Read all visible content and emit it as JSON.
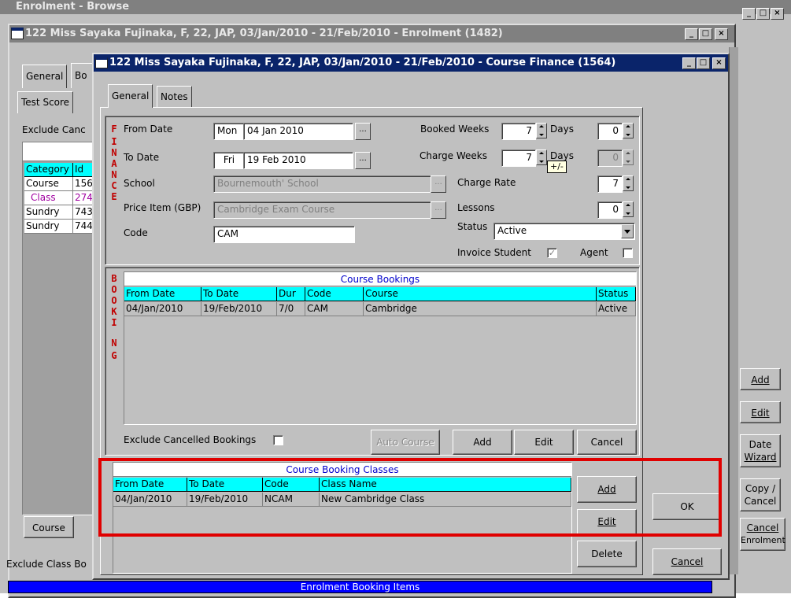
{
  "browse_window": {
    "title": "Enrolment - Browse"
  },
  "enrolment_window": {
    "title": "122 Miss Sayaka Fujinaka, F, 22, JAP, 03/Jan/2010 - 21/Feb/2010 - Enrolment (1482)",
    "tabs": [
      "General",
      "Bo"
    ],
    "subtab": "Test Score",
    "exclude_label": "Exclude Canc",
    "grid_headers": [
      "Category",
      "Id"
    ],
    "grid_rows": [
      [
        "Course",
        "156"
      ],
      [
        "Class",
        "274"
      ],
      [
        "Sundry",
        "743"
      ],
      [
        "Sundry",
        "744"
      ]
    ],
    "course_button": "Course",
    "exclude_class_label": "Exclude Class Bo",
    "bottom_bar": "Enrolment Booking Items",
    "side_buttons": {
      "add": "Add",
      "edit": "Edit",
      "date_wizard": [
        "Date",
        "Wizard"
      ],
      "copy_cancel": [
        "Copy /",
        "Cancel"
      ],
      "cancel_enrolment": [
        "Cancel",
        "Enrolment"
      ]
    }
  },
  "finance_window": {
    "title": "122 Miss Sayaka Fujinaka, F, 22, JAP, 03/Jan/2010 - 21/Feb/2010 - Course Finance (1564)",
    "tabs": [
      "General",
      "Notes"
    ],
    "finance_letters": [
      "F",
      "I",
      "N",
      "A",
      "N",
      "C",
      "E"
    ],
    "booking_letters": [
      "B",
      "O",
      "O",
      "K",
      "I",
      "N",
      "G"
    ],
    "from_date": {
      "label": "From Date",
      "day": "Mon",
      "value": "04 Jan 2010"
    },
    "to_date": {
      "label": "To Date",
      "day": "Fri",
      "value": "19 Feb 2010"
    },
    "school": {
      "label": "School",
      "value": "Bournemouth' School"
    },
    "price_item": {
      "label": "Price Item (GBP)",
      "value": "Cambridge Exam Course"
    },
    "code": {
      "label": "Code",
      "value": "CAM"
    },
    "booked_weeks": {
      "label": "Booked Weeks",
      "value": "7",
      "days_label": "Days",
      "days": "0"
    },
    "charge_weeks": {
      "label": "Charge Weeks",
      "value": "7",
      "days_label": "Days",
      "days": "0",
      "tooltip": "+/-"
    },
    "charge_rate": {
      "label": "Charge Rate",
      "value": "7"
    },
    "lessons": {
      "label": "Lessons",
      "value": "0"
    },
    "status": {
      "label": "Status",
      "value": "Active"
    },
    "invoice_student": {
      "label": "Invoice Student",
      "checked": true
    },
    "agent": {
      "label": "Agent",
      "checked": false
    },
    "course_bookings": {
      "caption": "Course Bookings",
      "headers": [
        "From Date",
        "To Date",
        "Dur",
        "Code",
        "Course",
        "Status"
      ],
      "rows": [
        [
          "04/Jan/2010",
          "19/Feb/2010",
          "7/0",
          "CAM",
          "Cambridge",
          "Active"
        ]
      ]
    },
    "exclude_cancelled_label": "Exclude Cancelled Bookings",
    "auto_course": "Auto Course",
    "add": "Add",
    "edit": "Edit",
    "cancel": "Cancel",
    "course_booking_classes": {
      "caption": "Course Booking Classes",
      "headers": [
        "From Date",
        "To Date",
        "Code",
        "Class Name"
      ],
      "rows": [
        [
          "04/Jan/2010",
          "19/Feb/2010",
          "NCAM",
          "New Cambridge Class"
        ]
      ]
    },
    "class_add": "Add",
    "class_edit": "Edit",
    "class_delete": "Delete",
    "ok": "OK",
    "cancel_dialog": "Cancel"
  },
  "colors": {
    "highlight": "#e00000",
    "grid_header": "#00ffff",
    "title_active": "#0a246a",
    "caption_text": "#0000cc"
  }
}
